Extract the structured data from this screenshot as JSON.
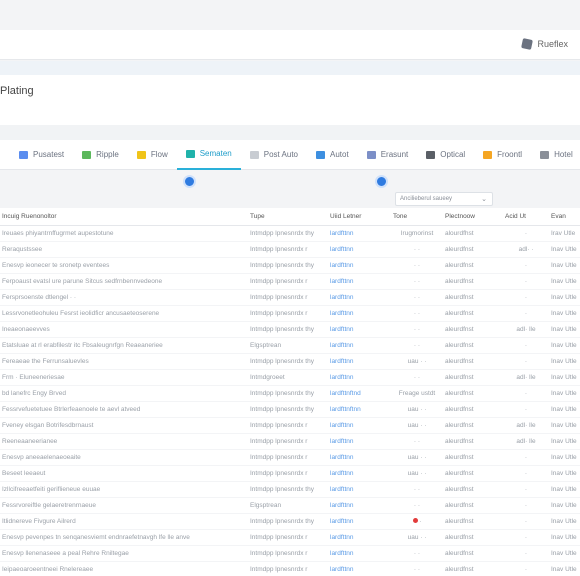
{
  "topbar": {
    "action_label": "Rueflex",
    "action_icon": "pin-icon"
  },
  "header": {
    "title": "Plating"
  },
  "toolbar": {
    "tools": [
      {
        "label": "Pusatest",
        "color": "#5b8def",
        "active": false
      },
      {
        "label": "Ripple",
        "color": "#5cb85c",
        "active": false
      },
      {
        "label": "Flow",
        "color": "#f0c419",
        "active": false
      },
      {
        "label": "Sematen",
        "color": "#20b2aa",
        "active": true
      },
      {
        "label": "Post Auto",
        "color": "#c8ccd2",
        "active": false
      },
      {
        "label": "Autot",
        "color": "#3d8fe0",
        "active": false
      },
      {
        "label": "Erasunt",
        "color": "#7c8fc7",
        "active": false
      },
      {
        "label": "Optical",
        "color": "#5a5f66",
        "active": false
      },
      {
        "label": "Froontl",
        "color": "#f5a623",
        "active": false
      },
      {
        "label": "Hotel",
        "color": "#8a8f98",
        "active": false
      }
    ]
  },
  "filter": {
    "value": "Ancilieberul saueey"
  },
  "table": {
    "headers": [
      "Incuig Ruenonoltor",
      "Tupe",
      "Uiid Letner",
      "Tone",
      "Plectnoow",
      "Acid Ut",
      "Evan"
    ],
    "rows": [
      [
        "Ireuaes phiyantrnffugrmet aupestotune",
        "Intmdpp lpnesnrdx thy",
        "lardfttnn",
        "Irugmorinst",
        "alourdfhst",
        "·",
        "Irav Utle"
      ],
      [
        "Reraqustssee",
        "Intmdpp lpnesnrdx r",
        "lardfttnn",
        "· ·",
        "aleurdfnst",
        "adl· ·",
        "Inav Utle"
      ],
      [
        "Enesvp ieonecer te sronetp eventees",
        "Intmdpp lpnesnrdx thy",
        "lardfttnn",
        "· ·",
        "aleurdfnst",
        "·",
        "Inav Utle"
      ],
      [
        "Ferpoaust evatsl ure parune Sitcus sedfrnbennvedeone",
        "Intmdpp lpnesnrdx r",
        "lardfttnn",
        "· ·",
        "aleurdfnst",
        "·",
        "Inav Utle"
      ],
      [
        "Fersprsoenste dtlengel · ·",
        "Intmdpp lpnesnrdx r",
        "lardfttnn",
        "· ·",
        "aleurdfnst",
        "·",
        "Inav Utle"
      ],
      [
        "Lessrvonetleohuleu Fesrst ieolidficr ancusaeteoserene",
        "Intmdpp lpnesnrdx r",
        "lardfttnn",
        "· ·",
        "aleurdfnst",
        "·",
        "Inav Utle"
      ],
      [
        "Ineaeonaeevves",
        "Intmdpp lpnesnrdx thy",
        "lardfttnn",
        "· ·",
        "aleurdfnst",
        "adl· lle",
        "Inav Utle"
      ],
      [
        "Etatsluae at rl erabfilestr itc Fbsaleugnrfgn Reaeaneriee",
        "Elgsptrean",
        "lardfttnn",
        "· ·",
        "aleurdfnst",
        "·",
        "Inav Utle"
      ],
      [
        "Fereaeae the Ferrunsaluevles",
        "Intmdpp lpnesnrdx thy",
        "lardfttnn",
        "uau · ·",
        "aleurdfnst",
        "·",
        "Inav Utle"
      ],
      [
        "Frm · Eluneeneriesae",
        "Intmdgroeet",
        "lardfttnn",
        "· ·",
        "aleurdfnst",
        "adl· lle",
        "Inav Utle"
      ],
      [
        "bd lanefrc Engy Brved",
        "Intmdpp lpnesnrdx thy",
        "lardfttnftnd",
        "Freage ustdt",
        "aleurdfnst",
        "·",
        "Inav Utle"
      ],
      [
        "Fessrvefuetetuee Btrlerfeaenoele te aevl atveed",
        "Intmdpp lpnesnrdx thy",
        "lardfttnftnn",
        "uau · ·",
        "aleurdfnst",
        "·",
        "Inav Utle"
      ],
      [
        "Fveney elsgan Botrifesdbrnaust",
        "Intmdpp lpnesnrdx r",
        "lardfttnn",
        "uau · ·",
        "aleurdfnst",
        "adl· lle",
        "Inav Utle"
      ],
      [
        "Reeneaaneerianee",
        "Intmdpp lpnesnrdx r",
        "lardfttnn",
        "· ·",
        "aleurdfnst",
        "adl· lle",
        "Inav Utle"
      ],
      [
        "Enesvp aneeaelenaeoeaite",
        "Intmdpp lpnesnrdx r",
        "lardfttnn",
        "uau · ·",
        "aleurdfnst",
        "·",
        "Inav Utle"
      ],
      [
        "Beseet leeaeut",
        "Intmdpp lpnesnrdx r",
        "lardfttnn",
        "uau · ·",
        "aleurdfnst",
        "·",
        "Inav Utle"
      ],
      [
        "Izllcifreeaetfeiti geriflieneue euuae",
        "Intmdpp lpnesnrdx thy",
        "lardfttnn",
        "· ·",
        "aleurdfnst",
        "·",
        "Inav Utle"
      ],
      [
        "Fessrvoreiftle gelaeretrenrnaeue",
        "Elgsptrean",
        "lardfttnn",
        "· ·",
        "aleurdfnst",
        "·",
        "Inav Utle"
      ],
      [
        "Itlidnereve Fivgure Ailrerd",
        "Intmdpp lpnesnrdx thy",
        "lardfttnn",
        "● ·",
        "aleurdfnst",
        "·",
        "Inav Utle"
      ],
      [
        "Enesvp pevenpes tn senqanesviemt endnraefetnavgh lfe lle anve",
        "Intmdpp lpnesnrdx r",
        "lardfttnn",
        "uau · ·",
        "aleurdfnst",
        "·",
        "Inav Utle"
      ],
      [
        "Enesvp llenenaseee a peal Rehre Rniltegae",
        "Intmdpp lpnesnrdx r",
        "lardfttnn",
        "· ·",
        "aleurdfnst",
        "·",
        "Inav Utle"
      ],
      [
        "Ieipaeoaroeentneei Rnelereaee",
        "Intmdpp lpnesnrdx r",
        "lardfttnn",
        "· ·",
        "aleurdfnst",
        "·",
        "Inav Utle"
      ]
    ]
  }
}
